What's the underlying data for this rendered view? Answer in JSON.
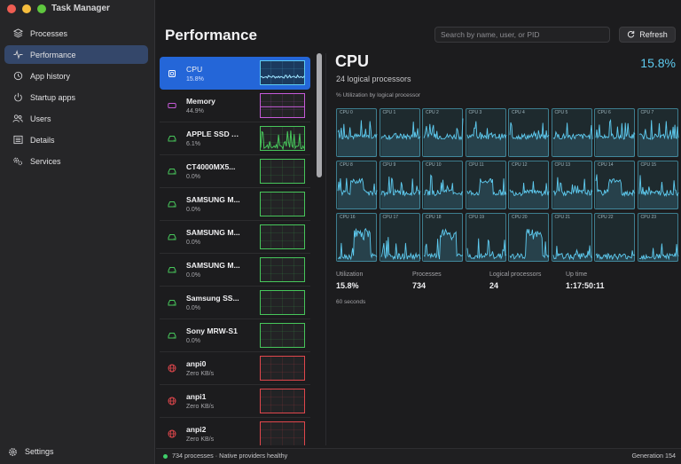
{
  "app": {
    "title": "Task Manager"
  },
  "sidebar": {
    "items": [
      {
        "label": "Processes",
        "icon": "layers-icon",
        "active": false
      },
      {
        "label": "Performance",
        "icon": "pulse-icon",
        "active": true
      },
      {
        "label": "App history",
        "icon": "history-icon",
        "active": false
      },
      {
        "label": "Startup apps",
        "icon": "power-icon",
        "active": false
      },
      {
        "label": "Users",
        "icon": "users-icon",
        "active": false
      },
      {
        "label": "Details",
        "icon": "list-icon",
        "active": false
      },
      {
        "label": "Services",
        "icon": "gears-icon",
        "active": false
      }
    ],
    "settings_label": "Settings"
  },
  "header": {
    "title": "Performance",
    "search_placeholder": "Search by name, user, or PID",
    "refresh_label": "Refresh"
  },
  "devices": [
    {
      "name": "CPU",
      "sub": "15.8%",
      "kind": "cpu",
      "color": "#5ecbf0",
      "active": true
    },
    {
      "name": "Memory",
      "sub": "44.9%",
      "kind": "memory",
      "color": "#c65ad8",
      "active": false
    },
    {
      "name": "APPLE SSD A...",
      "sub": "6.1%",
      "kind": "disk",
      "color": "#47c65b",
      "active": false
    },
    {
      "name": "CT4000MX5...",
      "sub": "0.0%",
      "kind": "disk",
      "color": "#47c65b",
      "active": false
    },
    {
      "name": "SAMSUNG M...",
      "sub": "0.0%",
      "kind": "disk",
      "color": "#47c65b",
      "active": false
    },
    {
      "name": "SAMSUNG M...",
      "sub": "0.0%",
      "kind": "disk",
      "color": "#47c65b",
      "active": false
    },
    {
      "name": "SAMSUNG M...",
      "sub": "0.0%",
      "kind": "disk",
      "color": "#47c65b",
      "active": false
    },
    {
      "name": "Samsung SS...",
      "sub": "0.0%",
      "kind": "disk",
      "color": "#47c65b",
      "active": false
    },
    {
      "name": "Sony MRW-S1",
      "sub": "0.0%",
      "kind": "disk",
      "color": "#47c65b",
      "active": false
    },
    {
      "name": "anpi0",
      "sub": "Zero KB/s",
      "kind": "network",
      "color": "#e0474c",
      "active": false
    },
    {
      "name": "anpi1",
      "sub": "Zero KB/s",
      "kind": "network",
      "color": "#e0474c",
      "active": false
    },
    {
      "name": "anpi2",
      "sub": "Zero KB/s",
      "kind": "network",
      "color": "#e0474c",
      "active": false
    }
  ],
  "cpu": {
    "title": "CPU",
    "subtitle": "24 logical processors",
    "utilization": "15.8%",
    "grid_caption": "% Utilization by logical processor",
    "accent": "#5ecbf0",
    "processors": [
      "CPU 0",
      "CPU 1",
      "CPU 2",
      "CPU 3",
      "CPU 4",
      "CPU 5",
      "CPU 6",
      "CPU 7",
      "CPU 8",
      "CPU 9",
      "CPU 10",
      "CPU 11",
      "CPU 12",
      "CPU 13",
      "CPU 14",
      "CPU 15",
      "CPU 16",
      "CPU 17",
      "CPU 18",
      "CPU 19",
      "CPU 20",
      "CPU 21",
      "CPU 22",
      "CPU 23"
    ],
    "stats": [
      {
        "label": "Utilization",
        "value": "15.8%"
      },
      {
        "label": "Processes",
        "value": "734"
      },
      {
        "label": "Logical processors",
        "value": "24"
      },
      {
        "label": "Up time",
        "value": "1:17:50:11"
      }
    ],
    "window_label": "60 seconds"
  },
  "status": {
    "text": "734 processes · Native providers healthy",
    "generation": "Generation 154",
    "healthy_color": "#3fcf6a"
  }
}
